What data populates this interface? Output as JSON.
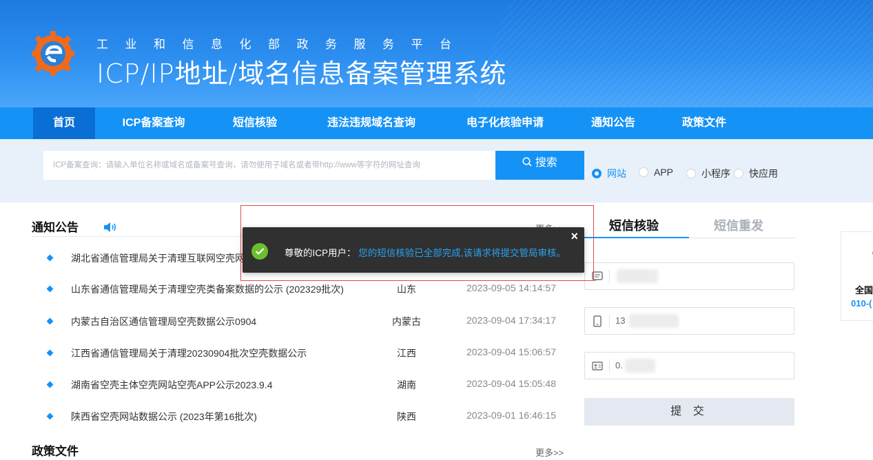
{
  "header": {
    "subtitle": "工业和信息化部政务服务平台",
    "title": "ICP/IP地址/域名信息备案管理系统"
  },
  "nav": {
    "items": [
      {
        "label": "首页",
        "active": true
      },
      {
        "label": "ICP备案查询",
        "active": false
      },
      {
        "label": "短信核验",
        "active": false
      },
      {
        "label": "违法违规域名查询",
        "active": false
      },
      {
        "label": "电子化核验申请",
        "active": false
      },
      {
        "label": "通知公告",
        "active": false
      },
      {
        "label": "政策文件",
        "active": false
      }
    ]
  },
  "search": {
    "placeholder": "ICP备案查询：请输入单位名称或域名或备案号查询，请勿使用子域名或者带http://www等字符的网址查询",
    "button_label": "搜索",
    "options": [
      {
        "label": "网站",
        "selected": true
      },
      {
        "label": "APP",
        "selected": false
      },
      {
        "label": "小程序",
        "selected": false
      },
      {
        "label": "快应用",
        "selected": false
      }
    ]
  },
  "notices": {
    "title": "通知公告",
    "more_label": "更多>>",
    "items": [
      {
        "title": "湖北省通信管理局关于清理互联网空壳网",
        "province": "",
        "date": ""
      },
      {
        "title": "山东省通信管理局关于清理空壳类备案数据的公示 (202329批次)",
        "province": "山东",
        "date": "2023-09-05 14:14:57"
      },
      {
        "title": "内蒙古自治区通信管理局空壳数据公示0904",
        "province": "内蒙古",
        "date": "2023-09-04 17:34:17"
      },
      {
        "title": "江西省通信管理局关于清理20230904批次空壳数据公示",
        "province": "江西",
        "date": "2023-09-04 15:06:57"
      },
      {
        "title": "湖南省空壳主体空壳网站空壳APP公示2023.9.4",
        "province": "湖南",
        "date": "2023-09-04 15:05:48"
      },
      {
        "title": "陕西省空壳网站数据公示 (2023年第16批次)",
        "province": "陕西",
        "date": "2023-09-01 16:46:15"
      }
    ]
  },
  "policy": {
    "title": "政策文件",
    "more_label": "更多>>"
  },
  "sms": {
    "tabs": [
      {
        "label": "短信核验",
        "active": true
      },
      {
        "label": "短信重发",
        "active": false
      }
    ],
    "fields": [
      {
        "icon": "message-icon",
        "value": ""
      },
      {
        "icon": "phone-icon",
        "value": "13"
      },
      {
        "icon": "id-card-icon",
        "value": "0."
      }
    ],
    "submit_label": "提 交"
  },
  "side_card": {
    "line1": "全国",
    "line2": "010-("
  },
  "toast": {
    "lead": "尊敬的ICP用户：",
    "message": "您的短信核验已全部完成,该请求将提交管局审核。",
    "close_label": "×"
  },
  "colors": {
    "brand_blue": "#1592f6",
    "nav_active": "#0a6fd4",
    "toast_bg": "#303030",
    "success_green": "#6bbf2e",
    "highlight_red": "#e04a4a"
  }
}
